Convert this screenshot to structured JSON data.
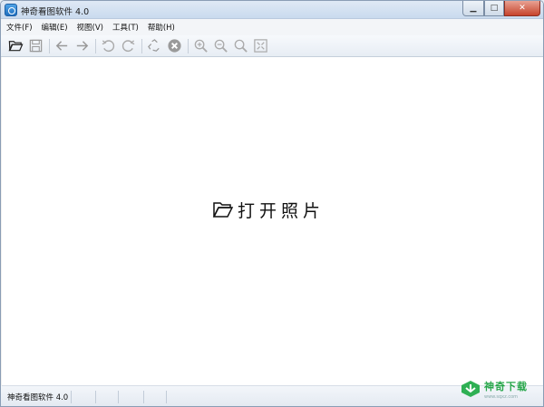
{
  "window": {
    "title": "神奇看图软件 4.0"
  },
  "menu": [
    {
      "label": "文件(F)",
      "name": "menu-file"
    },
    {
      "label": "编辑(E)",
      "name": "menu-edit"
    },
    {
      "label": "视图(V)",
      "name": "menu-view"
    },
    {
      "label": "工具(T)",
      "name": "menu-tools"
    },
    {
      "label": "帮助(H)",
      "name": "menu-help"
    }
  ],
  "toolbar": {
    "icons": [
      "open-folder-icon",
      "save-icon",
      "back-arrow-icon",
      "forward-arrow-icon",
      "rotate-left-icon",
      "rotate-right-icon",
      "recycle-icon",
      "delete-icon",
      "zoom-in-icon",
      "zoom-out-icon",
      "zoom-actual-icon",
      "fit-window-icon"
    ]
  },
  "canvas": {
    "open_photo_label": "打开照片"
  },
  "status": {
    "app_version": "神奇看图软件 4.0"
  },
  "watermark": {
    "title": "神奇下载",
    "subtitle": "www.sqxz.com"
  }
}
